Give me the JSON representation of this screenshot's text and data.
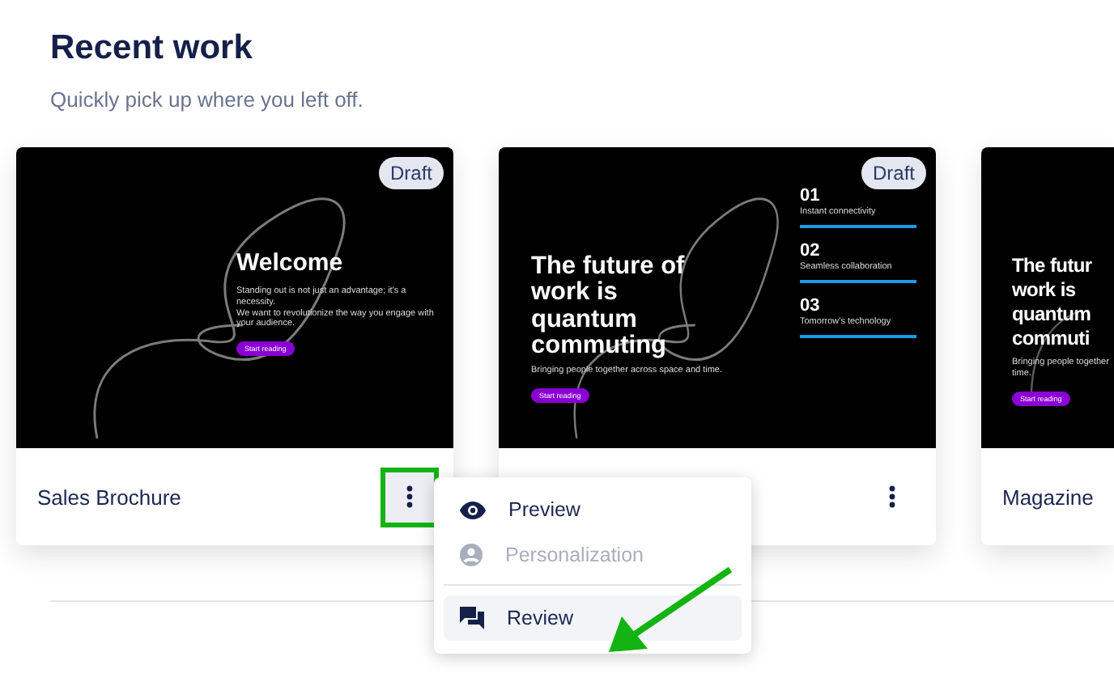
{
  "header": {
    "title": "Recent work",
    "subtitle": "Quickly pick up where you left off."
  },
  "cards": [
    {
      "name": "Sales Brochure",
      "badge": "Draft",
      "menu_open": true,
      "slide": {
        "kind": "intro",
        "title_lines": [
          "Welcome"
        ],
        "body": [
          "Standing out is not just an advantage; it's a necessity.",
          "We want to revolutionize the way you engage with your audience."
        ],
        "button": "Start reading"
      }
    },
    {
      "badge": "Draft",
      "menu_open": false,
      "slide": {
        "kind": "agenda",
        "title_lines": [
          "The future of",
          "work is",
          "quantum",
          "commuting"
        ],
        "body": [
          "Bringing people together across space and time."
        ],
        "button": "Start reading",
        "items": [
          {
            "number": "01",
            "label": "Instant connectivity"
          },
          {
            "number": "02",
            "label": "Seamless collaboration"
          },
          {
            "number": "03",
            "label": "Tomorrow's technology"
          }
        ]
      }
    },
    {
      "name": "Magazine",
      "slide": {
        "kind": "cut",
        "title_lines": [
          "The futur",
          "work is",
          "quantum",
          "commuti"
        ],
        "body": [
          "Bringing people together",
          "time."
        ],
        "button": "Start reading"
      }
    }
  ],
  "menu": {
    "items": [
      {
        "label": "Preview",
        "disabled": false,
        "selected": false
      },
      {
        "label": "Personalization",
        "disabled": true,
        "selected": false
      },
      {
        "label": "Review",
        "disabled": false,
        "selected": true
      }
    ]
  }
}
